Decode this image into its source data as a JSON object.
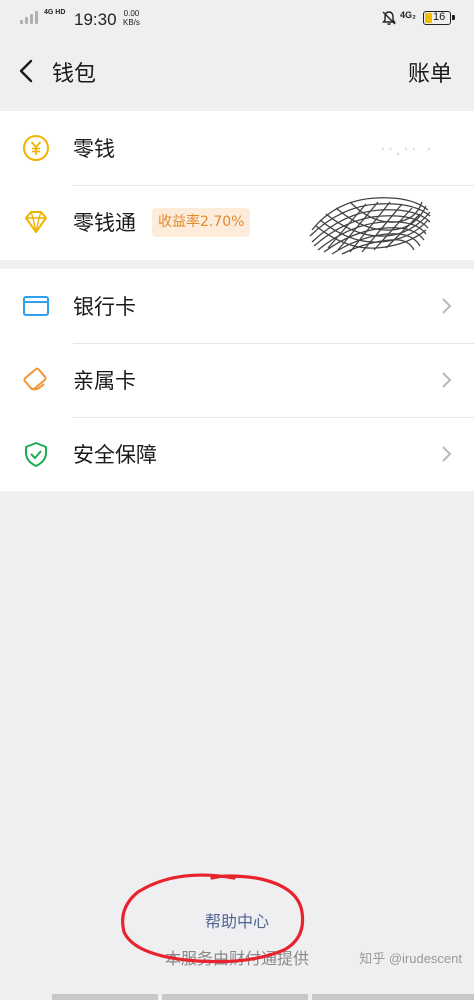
{
  "status_bar": {
    "network": "4G HD",
    "time": "19:30",
    "speed_value": "0.00",
    "speed_unit": "KB/s",
    "sim2": "4G₂",
    "battery": "16"
  },
  "nav": {
    "title": "钱包",
    "right_action": "账单"
  },
  "wallet": {
    "change": {
      "label": "零钱",
      "value_obscured": "··.·· ·"
    },
    "lingqiantong": {
      "label": "零钱通",
      "badge": "收益率2.70%"
    }
  },
  "cards": {
    "items": [
      {
        "label": "银行卡"
      },
      {
        "label": "亲属卡"
      },
      {
        "label": "安全保障"
      }
    ]
  },
  "footer": {
    "help": "帮助中心",
    "provider": "本服务由财付通提供",
    "watermark": "知乎 @irudescent"
  },
  "colors": {
    "accent_yellow": "#f0b400",
    "card_blue": "#2f9ff0",
    "family_orange": "#f0953a",
    "shield_green": "#1aad52",
    "annotation_red": "#e8232d"
  },
  "icons": {
    "change": "yuan-coin-icon",
    "lingqiantong": "diamond-icon",
    "bank_card": "bank-card-icon",
    "family_card": "family-card-icon",
    "security": "shield-check-icon"
  }
}
